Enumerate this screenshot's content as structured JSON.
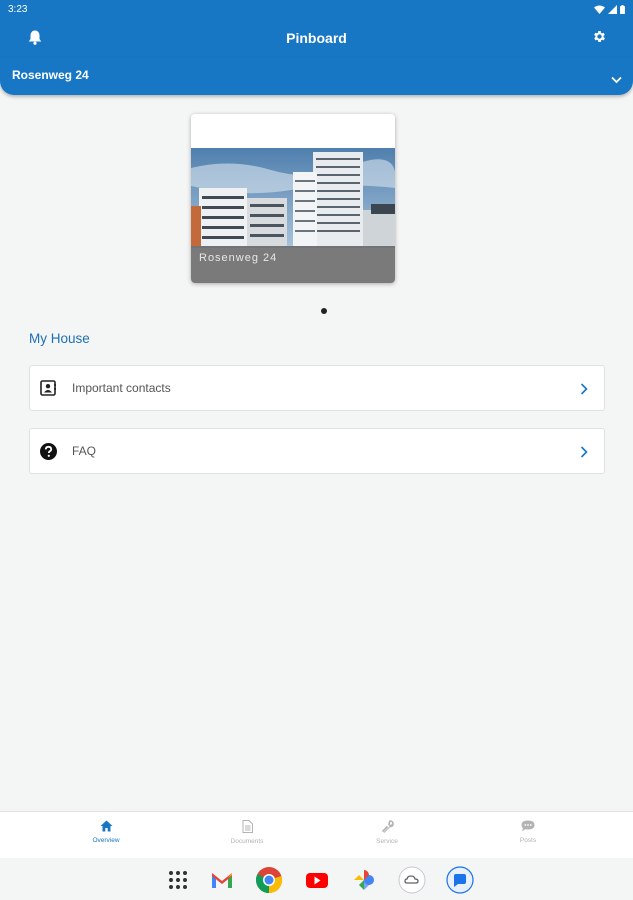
{
  "status_bar": {
    "time": "3:23"
  },
  "app_bar": {
    "title": "Pinboard"
  },
  "property_selector": {
    "value": "Rosenweg 24"
  },
  "carousel": {
    "cards": [
      {
        "label": "Rosenweg 24"
      }
    ],
    "active_index": 0
  },
  "my_house": {
    "title": "My House",
    "items": [
      {
        "label": "Important contacts",
        "icon": "contact-card-icon"
      },
      {
        "label": "FAQ",
        "icon": "question-circle-icon"
      }
    ]
  },
  "bottom_nav": {
    "items": [
      {
        "label": "Overview",
        "icon": "home-icon",
        "active": true
      },
      {
        "label": "Documents",
        "icon": "document-icon",
        "active": false
      },
      {
        "label": "Service",
        "icon": "wrench-icon",
        "active": false
      },
      {
        "label": "Posts",
        "icon": "chat-icon",
        "active": false
      }
    ]
  },
  "dock": {
    "apps": [
      "app-drawer-icon",
      "gmail-icon",
      "chrome-icon",
      "youtube-icon",
      "photos-icon",
      "cloud-app-icon",
      "messages-icon"
    ]
  },
  "colors": {
    "primary": "#1777c4",
    "background": "#f4f5f5",
    "section_title": "#1d6fb8"
  }
}
